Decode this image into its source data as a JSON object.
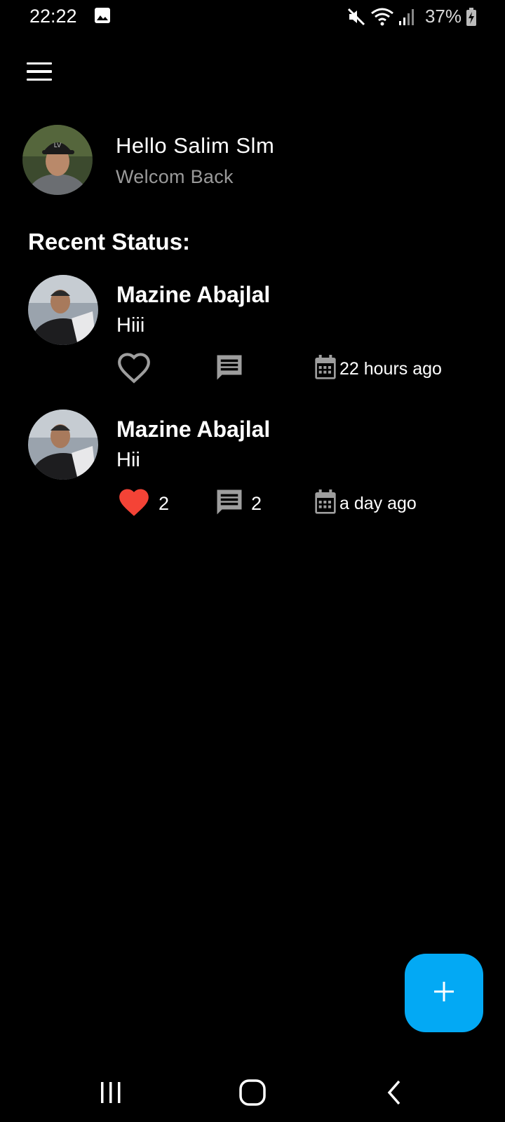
{
  "status_bar": {
    "time": "22:22",
    "battery": "37%",
    "icons": [
      "gallery-icon",
      "mute-icon",
      "wifi-icon",
      "signal-icon",
      "battery-charging-icon"
    ]
  },
  "header": {
    "menu_icon": "hamburger-menu-icon",
    "greeting": "Hello Salim Slm",
    "subtitle": "Welcom Back"
  },
  "section_title": "Recent Status:",
  "posts": [
    {
      "author": "Mazine Abajlal",
      "text": "Hiii",
      "liked": false,
      "like_count": "",
      "comment_count": "",
      "time": "22 hours ago"
    },
    {
      "author": "Mazine Abajlal",
      "text": "Hii",
      "liked": true,
      "like_count": "2",
      "comment_count": "2",
      "time": "a day ago"
    }
  ],
  "fab": {
    "icon": "plus-icon"
  },
  "colors": {
    "background": "#000000",
    "accent": "#03a9f4",
    "like_active": "#f44336",
    "icon_gray": "#9e9e9e",
    "subtitle_gray": "#9a9a9a"
  },
  "nav_bar": {
    "icons": [
      "recent-apps-icon",
      "home-icon",
      "back-icon"
    ]
  }
}
